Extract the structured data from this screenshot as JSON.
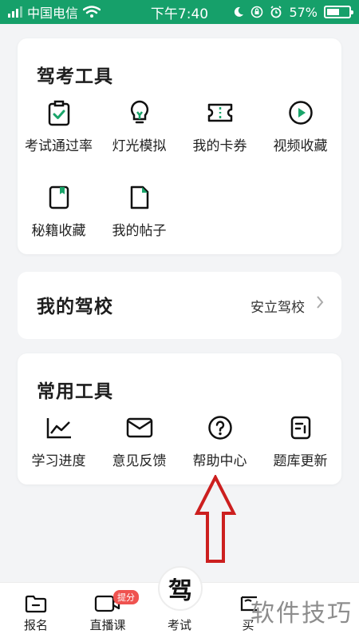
{
  "status_bar": {
    "carrier": "中国电信",
    "time": "下午7:40",
    "battery_percent": 57,
    "battery_text": "57%",
    "bg_color": "#16a06a"
  },
  "driving_tools": {
    "title": "驾考工具",
    "items": [
      {
        "label": "考试通过率",
        "icon": "clipboard-check-icon"
      },
      {
        "label": "灯光模拟",
        "icon": "lightbulb-icon"
      },
      {
        "label": "我的卡券",
        "icon": "coupon-icon"
      },
      {
        "label": "视频收藏",
        "icon": "play-circle-icon"
      },
      {
        "label": "秘籍收藏",
        "icon": "book-bookmark-icon"
      },
      {
        "label": "我的帖子",
        "icon": "document-icon"
      }
    ]
  },
  "my_school": {
    "title": "我的驾校",
    "value": "安立驾校"
  },
  "common_tools": {
    "title": "常用工具",
    "items": [
      {
        "label": "学习进度",
        "icon": "line-chart-icon"
      },
      {
        "label": "意见反馈",
        "icon": "envelope-icon"
      },
      {
        "label": "帮助中心",
        "icon": "help-circle-icon"
      },
      {
        "label": "题库更新",
        "icon": "list-document-icon"
      }
    ]
  },
  "tab_bar": {
    "items": [
      {
        "label": "报名",
        "icon": "folder-icon"
      },
      {
        "label": "直播课",
        "icon": "video-camera-icon"
      },
      {
        "label": "考试",
        "icon": "drive-logo-icon"
      },
      {
        "label": "买",
        "icon": "shop-icon"
      }
    ],
    "center_logo_text": "驾",
    "badge_text": "提分"
  },
  "watermark": "软件技巧",
  "accent_color": "#1aa56a",
  "arrow_color": "#cc1f1f"
}
